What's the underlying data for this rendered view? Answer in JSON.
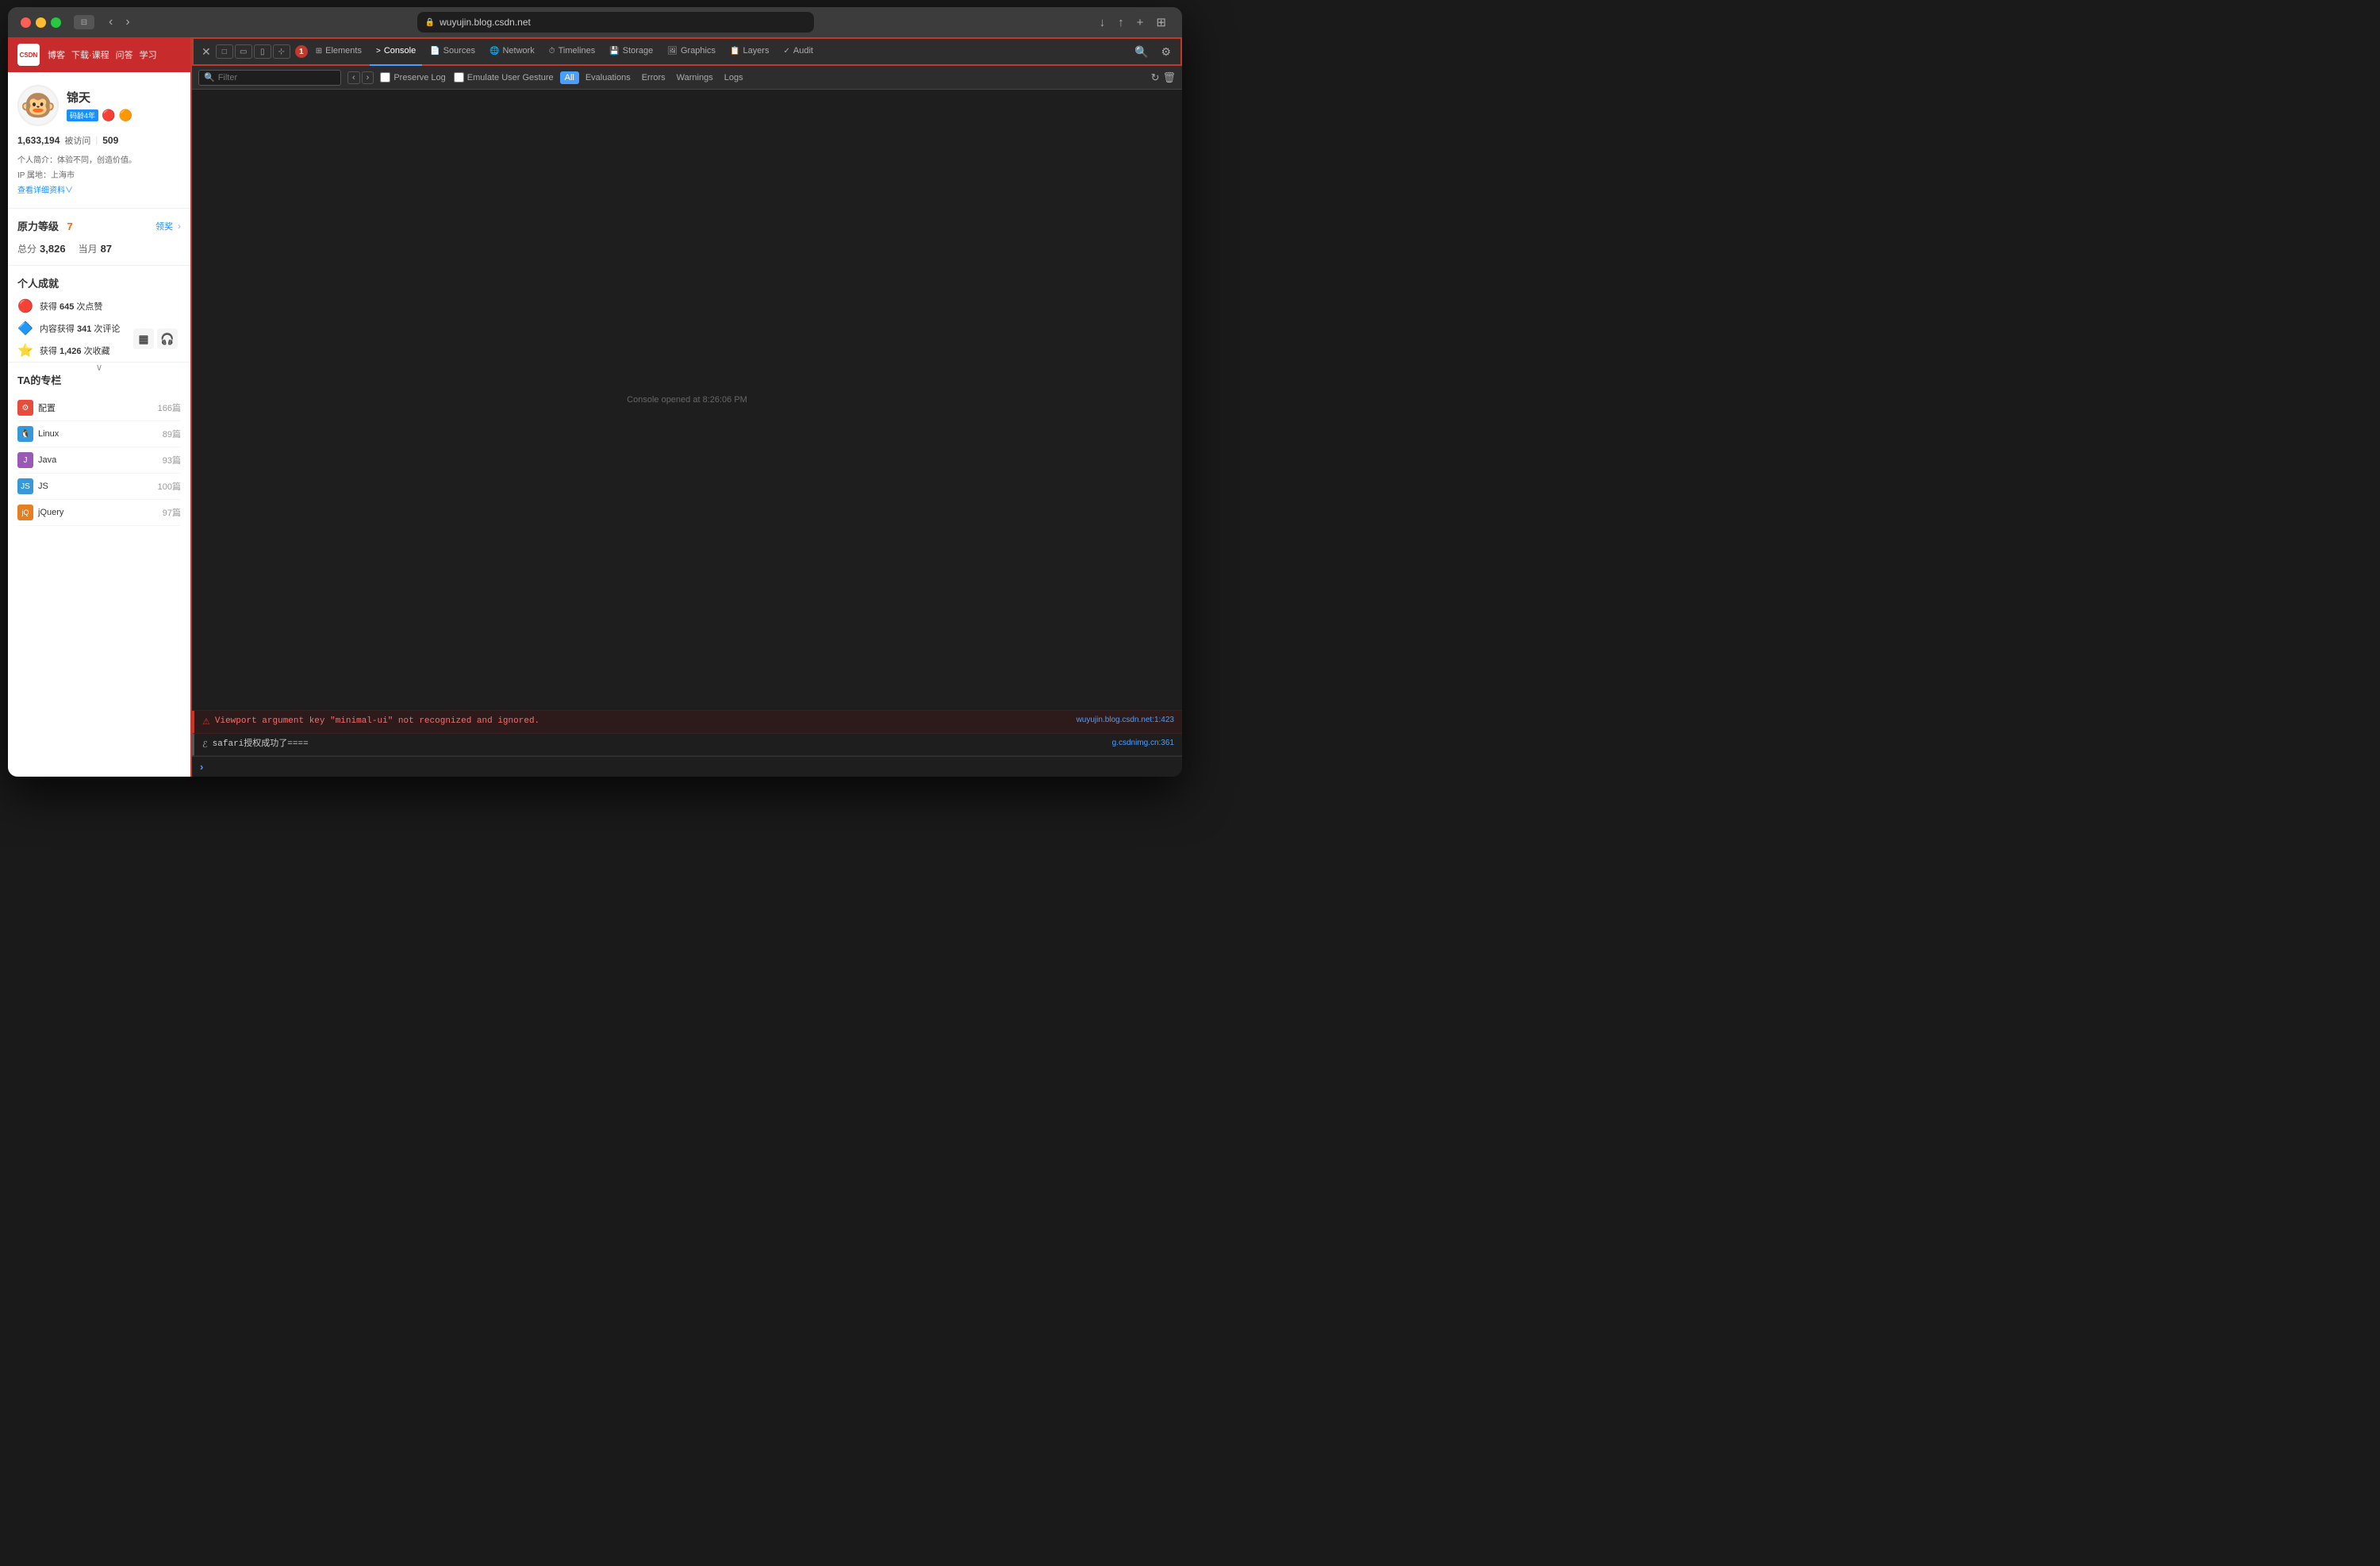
{
  "window": {
    "title": "wuyujin.blog.csdn.net"
  },
  "browser": {
    "url": "wuyujin.blog.csdn.net",
    "lock_icon": "🔒",
    "back_label": "‹",
    "forward_label": "›",
    "reload_label": "↻",
    "share_label": "↑",
    "add_tab_label": "+",
    "grid_label": "⊞",
    "download_label": "↓"
  },
  "site": {
    "logo": "CSDN",
    "nav_items": [
      "博客",
      "下载·课程",
      "问答",
      "学习"
    ]
  },
  "profile": {
    "name": "锦天",
    "avatar_emoji": "🐵",
    "visit_count": "1,633,194",
    "visit_label": "被访问",
    "rank": "509",
    "bio": "个人简介：体验不同，创造价值。",
    "location": "IP 属地：上海市",
    "detail_link": "查看详细资料∨"
  },
  "level": {
    "section_title": "原力等级",
    "level_num": "7",
    "action": "领奖",
    "total_score_label": "总分",
    "total_score": "3,826",
    "monthly_label": "当月",
    "monthly_score": "87"
  },
  "achievements": {
    "section_title": "个人成就",
    "items": [
      {
        "icon": "🔴",
        "text": "获得",
        "num": "645",
        "suffix": "次点赞"
      },
      {
        "icon": "🔷",
        "text": "内容获得",
        "num": "341",
        "suffix": "次评论"
      },
      {
        "icon": "⭐",
        "text": "获得",
        "num": "1,426",
        "suffix": "次收藏"
      }
    ]
  },
  "columns": {
    "section_title": "TA的专栏",
    "items": [
      {
        "name": "配置",
        "count": "166篇",
        "color": "#e74c3c"
      },
      {
        "name": "Linux",
        "count": "89篇",
        "color": "#3498db"
      },
      {
        "name": "Java",
        "count": "93篇",
        "color": "#9b59b6"
      },
      {
        "name": "JS",
        "count": "100篇",
        "color": "#3498db"
      },
      {
        "name": "jQuery",
        "count": "97篇",
        "color": "#e67e22"
      }
    ]
  },
  "devtools": {
    "tabs": [
      {
        "id": "elements",
        "label": "Elements",
        "icon": "⊞"
      },
      {
        "id": "console",
        "label": "Console",
        "icon": ">"
      },
      {
        "id": "sources",
        "label": "Sources",
        "icon": "📄"
      },
      {
        "id": "network",
        "label": "Network",
        "icon": "🌐"
      },
      {
        "id": "timelines",
        "label": "Timelines",
        "icon": "⏱"
      },
      {
        "id": "storage",
        "label": "Storage",
        "icon": "💾"
      },
      {
        "id": "graphics",
        "label": "Graphics",
        "icon": "🖼"
      },
      {
        "id": "layers",
        "label": "Layers",
        "icon": "📋"
      },
      {
        "id": "audit",
        "label": "Audit",
        "icon": "✓"
      }
    ],
    "active_tab": "console",
    "error_count": "1"
  },
  "console": {
    "search_placeholder": "Filter",
    "preserve_log_label": "Preserve Log",
    "emulate_gesture_label": "Emulate User Gesture",
    "filter_buttons": [
      "All",
      "Evaluations",
      "Errors",
      "Warnings",
      "Logs"
    ],
    "active_filter": "All",
    "opened_msg": "Console opened at 8:26:06 PM",
    "messages": [
      {
        "type": "error",
        "icon": "⚠",
        "text": "Viewport argument key \"minimal-ui\" not recognized and ignored.",
        "source": "wuyujin.blog.csdn.net:1:423"
      },
      {
        "type": "log",
        "icon": "ℰ",
        "text": "safari授权成功了====",
        "source": "g.csdnimg.cn:361"
      }
    ],
    "prompt": "›",
    "input_placeholder": ""
  }
}
